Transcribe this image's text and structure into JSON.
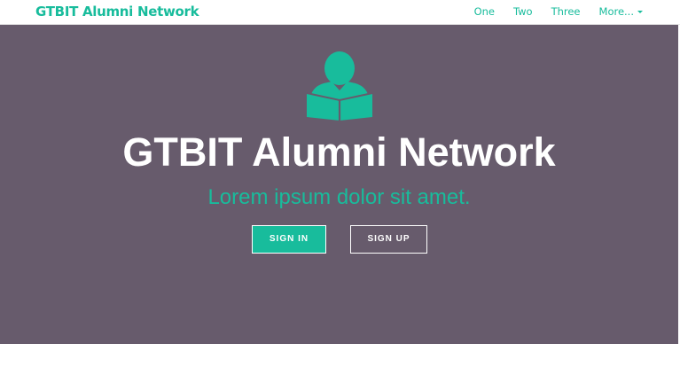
{
  "navbar": {
    "brand": "GTBIT Alumni Network",
    "links": [
      "One",
      "Two",
      "Three"
    ],
    "dropdown_label": "More..."
  },
  "hero": {
    "icon": "reader-icon",
    "title": "GTBIT Alumni Network",
    "subtitle": "Lorem ipsum dolor sit amet.",
    "signin_label": "SIGN IN",
    "signup_label": "SIGN UP"
  },
  "colors": {
    "accent": "#18bc9c",
    "hero_background": "#675b6c",
    "navbar_background": "#ffffff"
  }
}
